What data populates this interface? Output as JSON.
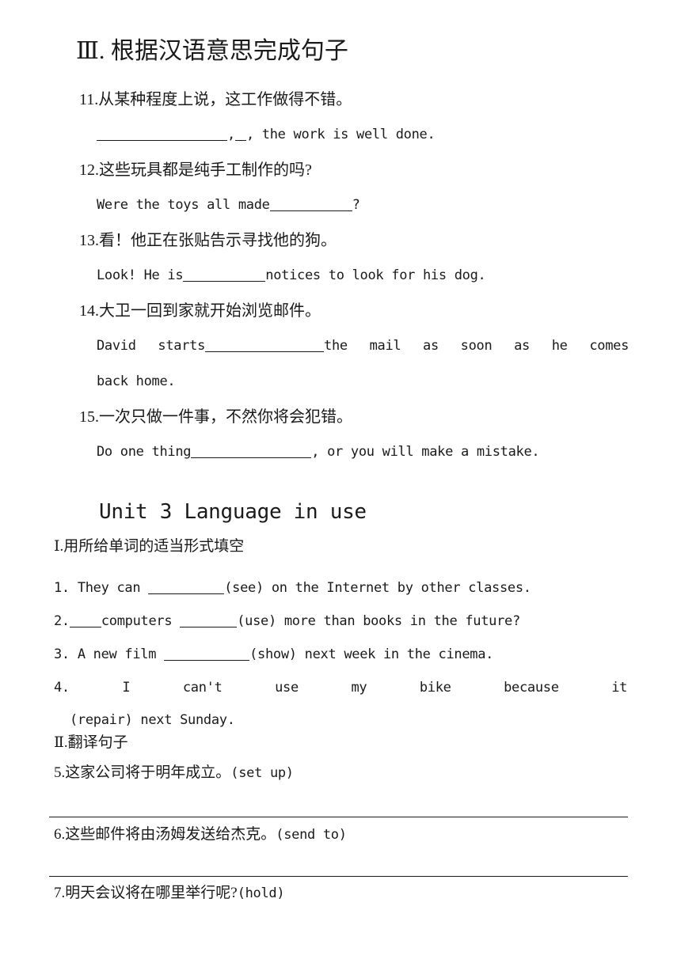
{
  "document": {
    "type": "worksheet",
    "language": "zh-CN + en",
    "background_color": "#ffffff",
    "text_color": "#1a1a1a"
  },
  "section_three": {
    "heading": "Ⅲ. 根据汉语意思完成句子",
    "items": [
      {
        "number": "11.",
        "chinese": "从某种程度上说，这工作做得不错。",
        "english_before": "",
        "english_after": ", the work is well done."
      },
      {
        "number": "12.",
        "chinese": "这些玩具都是纯手工制作的吗?",
        "english_before": "Were the toys all made",
        "english_after": "?"
      },
      {
        "number": "13.",
        "chinese": "看！他正在张贴告示寻找他的狗。",
        "english_before": "Look! He is",
        "english_after": "notices to look for his dog."
      },
      {
        "number": "14.",
        "chinese": "大卫一回到家就开始浏览邮件。",
        "english_before": "David starts",
        "english_after": "the mail as soon as he comes",
        "english_line2": "back home."
      },
      {
        "number": "15.",
        "chinese": "一次只做一件事，不然你将会犯错。",
        "english_before": "Do one thing",
        "english_after": ", or you will make a mistake."
      }
    ]
  },
  "unit": {
    "title": "Unit 3 Language in use"
  },
  "part_one": {
    "heading": "Ⅰ.用所给单词的适当形式填空",
    "items": [
      {
        "number": "1.",
        "before": "They can",
        "after": "(see) on the Internet by other classes."
      },
      {
        "number": "2.",
        "before": "",
        "middle": "computers",
        "after": "(use) more than books in the future?"
      },
      {
        "number": "3.",
        "before": "A new film",
        "after": "(show) next week in the cinema."
      },
      {
        "number": "4.",
        "words": [
          "I",
          "can't",
          "use",
          "my",
          "bike",
          "because",
          "it"
        ],
        "line2": "(repair) next Sunday."
      }
    ]
  },
  "part_two": {
    "heading": "Ⅱ.翻译句子",
    "items": [
      {
        "number": "5.",
        "chinese": "这家公司将于明年成立。",
        "hint": "(set up)"
      },
      {
        "number": "6.",
        "chinese": "这些邮件将由汤姆发送给杰克。",
        "hint": "(send to)"
      },
      {
        "number": "7.",
        "chinese": "明天会议将在哪里举行呢?",
        "hint": "(hold)"
      }
    ]
  }
}
